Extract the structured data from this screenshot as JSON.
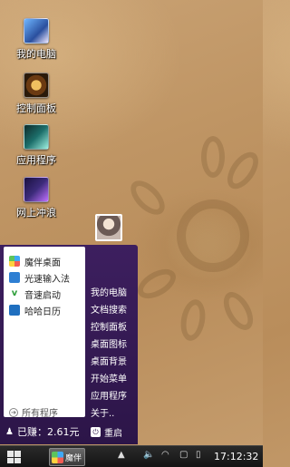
{
  "desktop": {
    "icons": [
      {
        "label": "我的电脑",
        "icon": "computer-icon",
        "color": "#2a4f9e"
      },
      {
        "label": "控制面板",
        "icon": "control-panel-icon",
        "color": "#6b3a12"
      },
      {
        "label": "应用程序",
        "icon": "applications-icon",
        "color": "#1c6e6a"
      },
      {
        "label": "网上冲浪",
        "icon": "internet-icon",
        "color": "#3c2b7a"
      }
    ]
  },
  "start_menu": {
    "left_items": [
      {
        "label": "魔伴桌面",
        "icon": "mobanzhuomian-icon",
        "color": "#3fa9f5"
      },
      {
        "label": "光速输入法",
        "icon": "input-method-icon",
        "color": "#2e7fd3"
      },
      {
        "label": "音速启动",
        "icon": "yinsu-launch-icon",
        "color": "#2e9e3a"
      },
      {
        "label": "哈哈日历",
        "icon": "calendar-icon",
        "color": "#1f6fbf"
      }
    ],
    "all_programs": "所有程序",
    "right_items": [
      "我的电脑",
      "文档搜索",
      "控制面板",
      "桌面图标",
      "桌面背景",
      "开始菜单",
      "应用程序",
      "关于.."
    ],
    "earned": "已赚：2.61元",
    "restart": "重启"
  },
  "taskbar": {
    "app_label": "魔伴",
    "time": "17:12:32"
  },
  "colors": {
    "menu_bg": "#2c1548",
    "taskbar_bg": "#141414"
  }
}
